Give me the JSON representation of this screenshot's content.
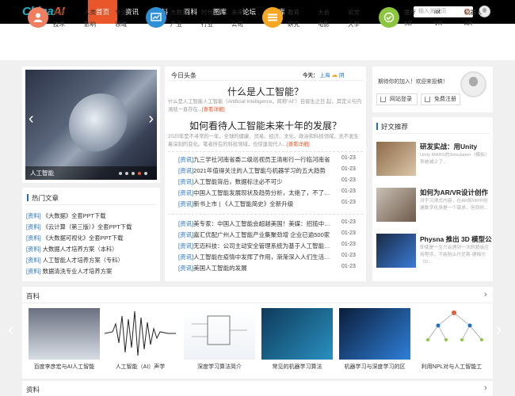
{
  "header": {
    "logo_part1": "China",
    "logo_part2": "AI",
    "nav": [
      "首页",
      "资讯",
      "资料",
      "百科",
      "图库",
      "论坛",
      "AI库"
    ],
    "search_placeholder": "输入关键词"
  },
  "categories": [
    {
      "icon": "user-icon",
      "color": "#f07f62",
      "labels": [
        "发展",
        "人类",
        "专业",
        "技术",
        "影响",
        "领域"
      ]
    },
    {
      "icon": "chart-icon",
      "color": "#2e8fd6",
      "labels": [
        "大数据",
        "时代",
        "未来",
        "产业",
        "行业",
        "公司"
      ]
    },
    {
      "icon": "list-icon",
      "color": "#f5a623",
      "labels": [
        "教育",
        "大会",
        "论文",
        "研究",
        "电影",
        "大学"
      ]
    },
    {
      "icon": "check-icon",
      "color": "#8cc63f",
      "labels": [
        "医疗",
        "iot",
        "机器人",
        "5G",
        "VR",
        "AR"
      ]
    }
  ],
  "slider": {
    "caption": "人工智能"
  },
  "hot": {
    "title": "热门文章",
    "items": [
      {
        "tag": "[资料]",
        "text": "《大数据》全套PPT下载"
      },
      {
        "tag": "[资料]",
        "text": "《云计算（第三版）》全套PPT下载"
      },
      {
        "tag": "[资料]",
        "text": "《大数据可视化》全套PPT下载"
      },
      {
        "tag": "[资料]",
        "text": "大数据人才培养方案（本科）"
      },
      {
        "tag": "[资料]",
        "text": "人工智能人才培养方案（专科）"
      },
      {
        "tag": "[资料]",
        "text": "数据清洗专业人才培养方案"
      }
    ]
  },
  "today": {
    "title": "今日头条",
    "weather_label": "今天：",
    "weather_city": "上海",
    "weather_state": "阴",
    "headline1": "什么是人工智能？",
    "summary1": "什么是人工智能人工智能（Artificial Intelligence，简称\"AI\"）自诞生之日 起，其定义与内涵就一直存在...",
    "more1": "[查看详细]",
    "headline2": "如何看待人工智能未来十年的发展？",
    "summary2": "2020年是不寻常的一年，全球的健康、贸易、经济、文化、政治和科技领域，无不发生着深刻的变化。笔者所在的科技领域，也惊逢现代人...",
    "more2": "[查看详细]",
    "news1": [
      {
        "tag": "[资讯]",
        "text": "九三学社河南省委二级巡视员王清彬行一行临河南省",
        "date": "01-23"
      },
      {
        "tag": "[资讯]",
        "text": "2021年值得关注的人工智能与机器学习的五大趋势",
        "date": "01-23"
      },
      {
        "tag": "[资讯]",
        "text": "人工智能背后，数据标注必不可少",
        "date": "01-23"
      },
      {
        "tag": "[资讯]",
        "text": "中国人工智能发展现状及趋势分析，太绝了，不了解一下",
        "date": "01-23"
      },
      {
        "tag": "[资讯]",
        "text": "新书上市 | 《人工智能简史》全新升级",
        "date": "01-23"
      }
    ],
    "news2": [
      {
        "tag": "[资讯]",
        "text": "美专家：中国人工智能会超越美国！美媒：招揽中国人才",
        "date": "01-23"
      },
      {
        "tag": "[资讯]",
        "text": "嘉汇优配广州人工智能产业集聚劲增 企业已逾500家",
        "date": "01-23"
      },
      {
        "tag": "[资讯]",
        "text": "无迈科技：公司主动安全管理系统为基于人工智能的汽车",
        "date": "01-23"
      },
      {
        "tag": "[资讯]",
        "text": "人工智能在疫情中发挥了作用，渐渐深入人们生活，未来",
        "date": "01-23"
      },
      {
        "tag": "[资讯]",
        "text": "美国人工智能的发展",
        "date": "01-23"
      }
    ]
  },
  "user": {
    "welcome": "期待你的加入！欢迎来投稿！",
    "login": "网站登录",
    "register": "免费注册"
  },
  "recommend": {
    "title": "好文推荐",
    "items": [
      {
        "title": "研发实战：用Unity",
        "desc": "Unity MARS的Simulation（模拟）系统减少了...",
        "colors": [
          "#8e6a4a",
          "#d9c7a7"
        ]
      },
      {
        "title": "如何为AR/VR设计创作",
        "desc": "对于沉浸式内容，在AR和VR中创建数字化身是一个需求，但同时...",
        "colors": [
          "#c9c0b5",
          "#6d5a4a"
        ]
      },
      {
        "title": "Physna 推出 3D 模型公",
        "desc": "即使是一生只会遇到一次的超级应用程序，不能阻止丹尼斯·德梅尔（D...",
        "colors": [
          "#1a2a45",
          "#3a7bd5"
        ]
      }
    ]
  },
  "baike": {
    "title": "百科",
    "items": [
      {
        "caption": "百度李彦宏与AI人工智能",
        "colors": [
          "#6a7080",
          "#d8dde4"
        ]
      },
      {
        "caption": "人工智能（AI）声学",
        "colors": [
          "#ffffff",
          "#ffffff"
        ]
      },
      {
        "caption": "深度学习算法简介",
        "colors": [
          "#ffffff",
          "#eef2f6"
        ]
      },
      {
        "caption": "常见的机器学习算法",
        "colors": [
          "#0e3a5a",
          "#2a90c0"
        ]
      },
      {
        "caption": "机器学习与深度学习的区",
        "colors": [
          "#0b1d3a",
          "#2f7fd8"
        ]
      },
      {
        "caption": "利用NPL对与人工智能工",
        "colors": [
          "#ffffff",
          "#ffffff"
        ]
      }
    ]
  },
  "ziliao": {
    "title": "资料"
  }
}
